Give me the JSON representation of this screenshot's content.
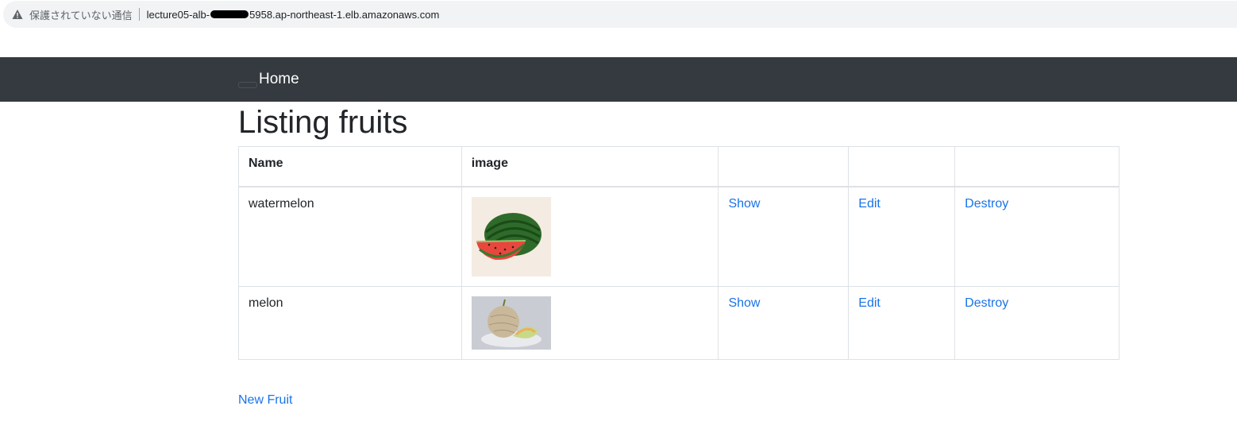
{
  "browser": {
    "security_label": "保護されていない通信",
    "url_prefix": "lecture05-alb-",
    "url_suffix": "5958.ap-northeast-1.elb.amazonaws.com",
    "icon": "warning-triangle-icon"
  },
  "navbar": {
    "home_label": "Home",
    "background": "#343a40"
  },
  "page": {
    "title": "Listing fruits"
  },
  "table": {
    "headers": [
      "Name",
      "image",
      "",
      "",
      ""
    ],
    "rows": [
      {
        "name": "watermelon",
        "image": "watermelon-image",
        "show": "Show",
        "edit": "Edit",
        "destroy": "Destroy"
      },
      {
        "name": "melon",
        "image": "melon-image",
        "show": "Show",
        "edit": "Edit",
        "destroy": "Destroy"
      }
    ]
  },
  "footer": {
    "new_link": "New Fruit"
  },
  "colors": {
    "link": "#1a73e8",
    "text": "#212529",
    "border": "#dee2e6"
  }
}
